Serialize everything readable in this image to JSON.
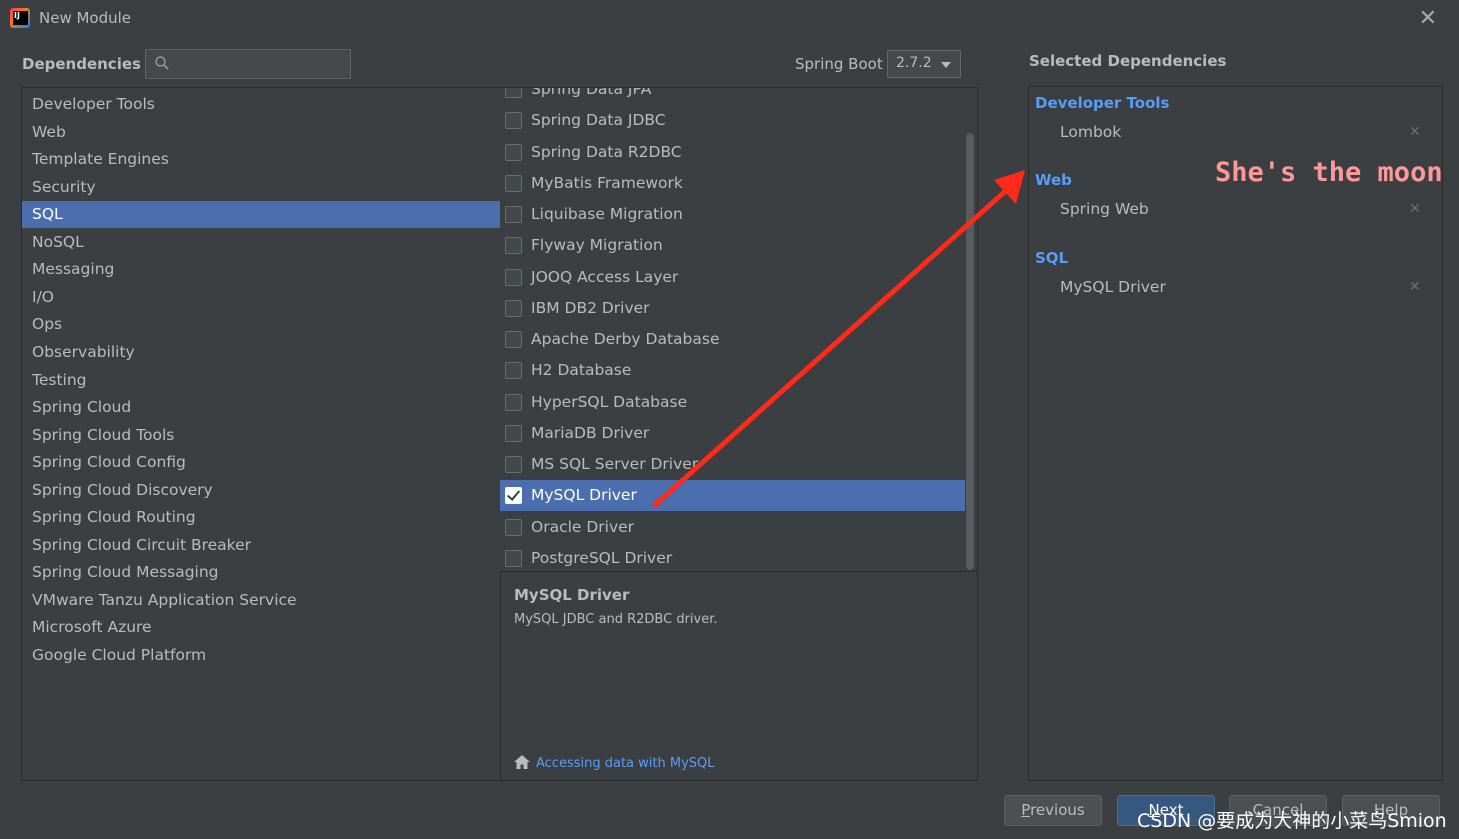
{
  "window": {
    "title": "New Module",
    "close_glyph": "✕"
  },
  "header": {
    "dependencies_label": "Dependencies",
    "search": {
      "value": "",
      "placeholder": ""
    },
    "spring_boot_label": "Spring Boot",
    "spring_boot_version": "2.7.2"
  },
  "categories": [
    {
      "label": "Developer Tools",
      "selected": false
    },
    {
      "label": "Web",
      "selected": false
    },
    {
      "label": "Template Engines",
      "selected": false
    },
    {
      "label": "Security",
      "selected": false
    },
    {
      "label": "SQL",
      "selected": true
    },
    {
      "label": "NoSQL",
      "selected": false
    },
    {
      "label": "Messaging",
      "selected": false
    },
    {
      "label": "I/O",
      "selected": false
    },
    {
      "label": "Ops",
      "selected": false
    },
    {
      "label": "Observability",
      "selected": false
    },
    {
      "label": "Testing",
      "selected": false
    },
    {
      "label": "Spring Cloud",
      "selected": false
    },
    {
      "label": "Spring Cloud Tools",
      "selected": false
    },
    {
      "label": "Spring Cloud Config",
      "selected": false
    },
    {
      "label": "Spring Cloud Discovery",
      "selected": false
    },
    {
      "label": "Spring Cloud Routing",
      "selected": false
    },
    {
      "label": "Spring Cloud Circuit Breaker",
      "selected": false
    },
    {
      "label": "Spring Cloud Messaging",
      "selected": false
    },
    {
      "label": "VMware Tanzu Application Service",
      "selected": false
    },
    {
      "label": "Microsoft Azure",
      "selected": false
    },
    {
      "label": "Google Cloud Platform",
      "selected": false
    }
  ],
  "dependencies": [
    {
      "label": "Spring Data JPA",
      "checked": false,
      "selected": false
    },
    {
      "label": "Spring Data JDBC",
      "checked": false,
      "selected": false
    },
    {
      "label": "Spring Data R2DBC",
      "checked": false,
      "selected": false
    },
    {
      "label": "MyBatis Framework",
      "checked": false,
      "selected": false
    },
    {
      "label": "Liquibase Migration",
      "checked": false,
      "selected": false
    },
    {
      "label": "Flyway Migration",
      "checked": false,
      "selected": false
    },
    {
      "label": "JOOQ Access Layer",
      "checked": false,
      "selected": false
    },
    {
      "label": "IBM DB2 Driver",
      "checked": false,
      "selected": false
    },
    {
      "label": "Apache Derby Database",
      "checked": false,
      "selected": false
    },
    {
      "label": "H2 Database",
      "checked": false,
      "selected": false
    },
    {
      "label": "HyperSQL Database",
      "checked": false,
      "selected": false
    },
    {
      "label": "MariaDB Driver",
      "checked": false,
      "selected": false
    },
    {
      "label": "MS SQL Server Driver",
      "checked": false,
      "selected": false
    },
    {
      "label": "MySQL Driver",
      "checked": true,
      "selected": true
    },
    {
      "label": "Oracle Driver",
      "checked": false,
      "selected": false
    },
    {
      "label": "PostgreSQL Driver",
      "checked": false,
      "selected": false
    }
  ],
  "description": {
    "title": "MySQL Driver",
    "text": "MySQL JDBC and R2DBC driver.",
    "link": "Accessing data with MySQL"
  },
  "selected": {
    "label": "Selected Dependencies",
    "groups": [
      {
        "name": "Developer Tools",
        "items": [
          "Lombok"
        ]
      },
      {
        "name": "Web",
        "items": [
          "Spring Web"
        ]
      },
      {
        "name": "SQL",
        "items": [
          "MySQL Driver"
        ]
      }
    ],
    "remove_glyph": "✕"
  },
  "annotation": {
    "text": "She's the moon -",
    "color": "#ff2a1a"
  },
  "buttons": {
    "previous_mnemonic": "P",
    "previous_rest": "revious",
    "next_mnemonic": "N",
    "next_rest": "ext",
    "cancel": "Cancel",
    "help": "Help"
  },
  "watermark": "CSDN @要成为大神的小菜鸟Smion",
  "colors": {
    "background": "#3c3f41",
    "selection": "#4b6eaf",
    "link": "#589df6",
    "primary_button": "#365880"
  }
}
